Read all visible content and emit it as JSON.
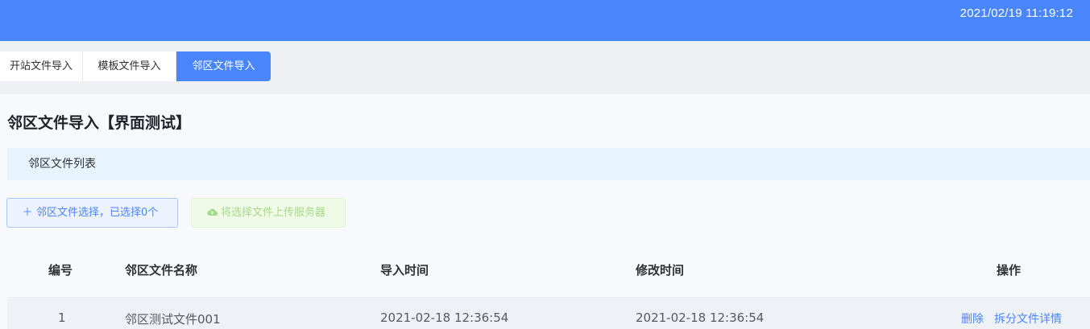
{
  "header": {
    "datetime": "2021/02/19 11:19:12"
  },
  "tabs": [
    {
      "label": "开站文件导入",
      "active": false
    },
    {
      "label": "模板文件导入",
      "active": false
    },
    {
      "label": "邻区文件导入",
      "active": true
    }
  ],
  "page": {
    "title": "邻区文件导入【界面测试】",
    "section_label": "邻区文件列表"
  },
  "actions": {
    "select_label": "邻区文件选择，已选择0个",
    "upload_label": "将选择文件上传服务器"
  },
  "table": {
    "columns": [
      "编号",
      "邻区文件名称",
      "导入时间",
      "修改时间",
      "操作"
    ],
    "rows": [
      {
        "id": "1",
        "name": "邻区测试文件001",
        "import_time": "2021-02-18 12:36:54",
        "modify_time": "2021-02-18 12:36:54",
        "ops": [
          "删除",
          "拆分文件详情"
        ]
      }
    ]
  },
  "colors": {
    "primary": "#4a86fb",
    "info_bg": "#e8f4fd",
    "success_disabled": "#a6d98a"
  }
}
